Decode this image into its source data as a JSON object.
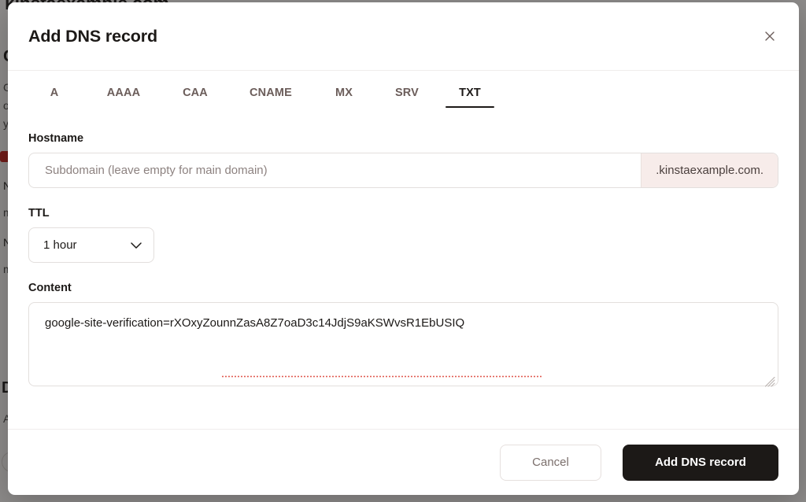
{
  "backdrop": {
    "domain_title": "kinstaexample.com",
    "section_heading": "C",
    "line_1": "G",
    "line_2": "o",
    "line_3": "y",
    "list_1": "N",
    "list_2": "m",
    "list_3": "N",
    "list_4": "m",
    "section_heading_2": "D",
    "list_5": "A"
  },
  "modal": {
    "title": "Add DNS record",
    "close_icon": "close-icon",
    "tabs": [
      {
        "label": "A",
        "active": false
      },
      {
        "label": "AAAA",
        "active": false
      },
      {
        "label": "CAA",
        "active": false
      },
      {
        "label": "CNAME",
        "active": false
      },
      {
        "label": "MX",
        "active": false
      },
      {
        "label": "SRV",
        "active": false
      },
      {
        "label": "TXT",
        "active": true
      }
    ],
    "fields": {
      "hostname": {
        "label": "Hostname",
        "value": "",
        "placeholder": "Subdomain (leave empty for main domain)",
        "suffix": ".kinstaexample.com."
      },
      "ttl": {
        "label": "TTL",
        "value": "1 hour",
        "options": [
          "1 hour"
        ],
        "chevron_icon": "chevron-down-icon"
      },
      "content": {
        "label": "Content",
        "value": "google-site-verification=rXOxyZounnZasA8Z7oaD3c14JdjS9aKSWvsR1EbUSIQ",
        "placeholder": ""
      }
    },
    "footer": {
      "cancel_label": "Cancel",
      "submit_label": "Add DNS record"
    }
  },
  "colors": {
    "accent_dark": "#1c1917",
    "tab_inactive": "#6b5d5a",
    "suffix_bg": "#f7ecea",
    "border": "#e3dfdd",
    "spellcheck": "#e05c52"
  }
}
